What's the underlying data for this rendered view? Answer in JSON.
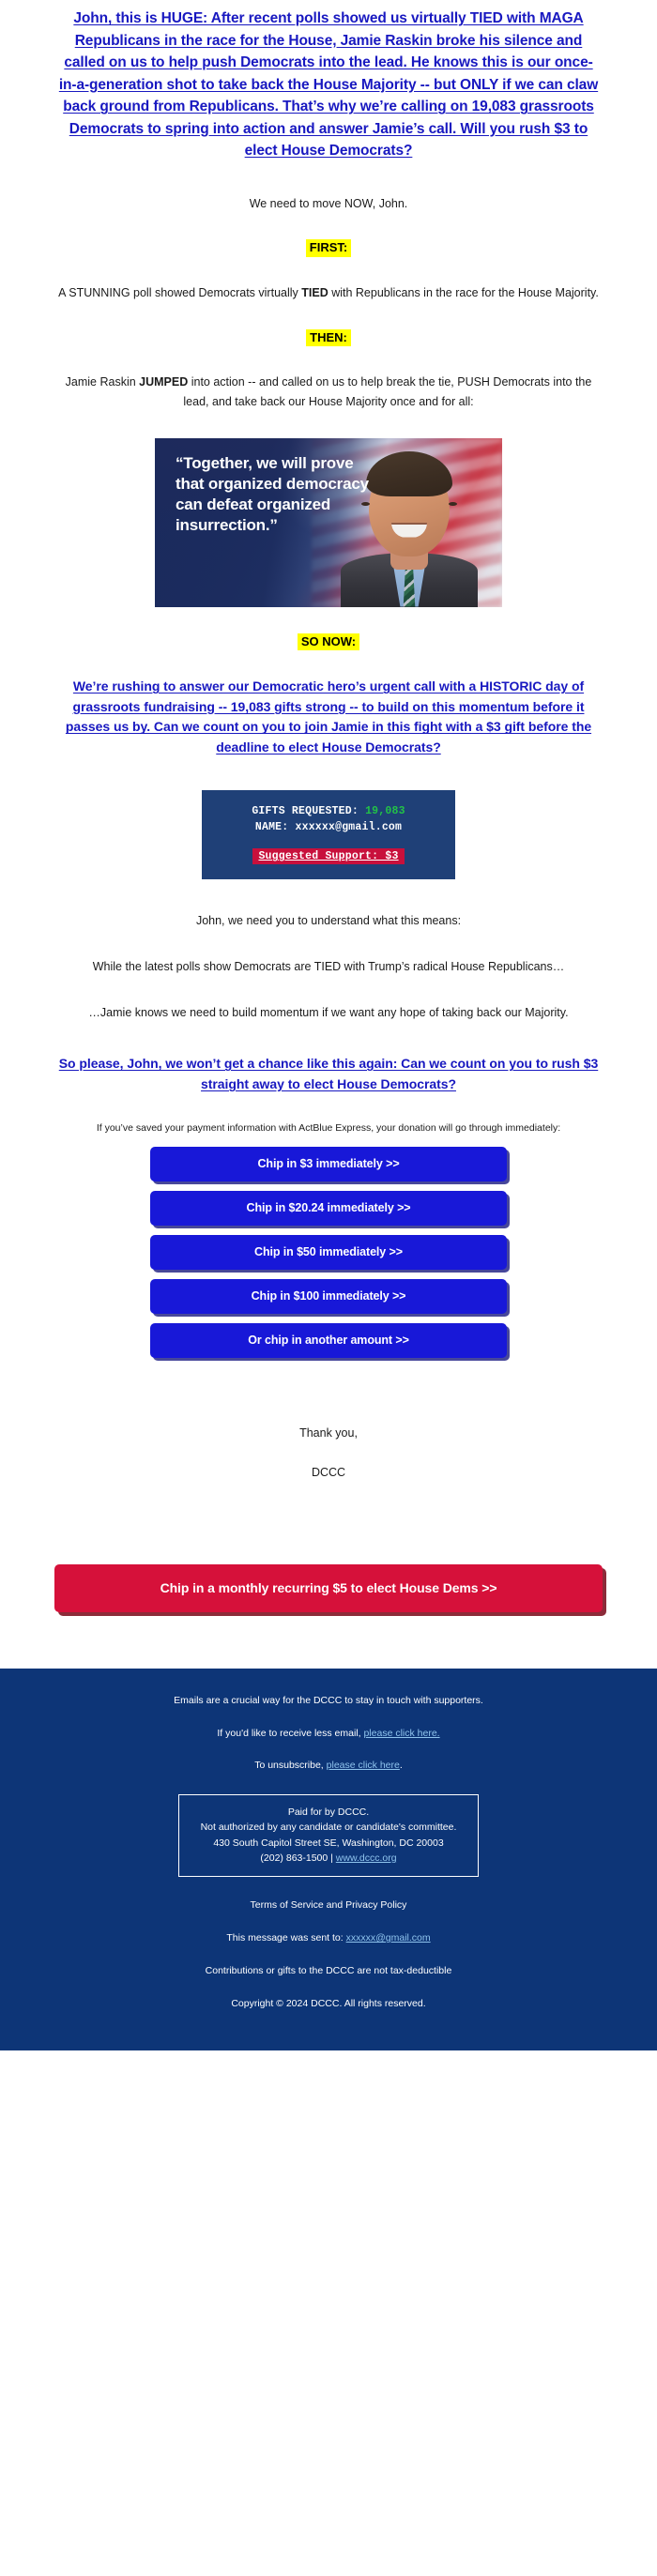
{
  "colors": {
    "headline_blue": "#1818c0",
    "highlight_yellow": "#ffff00",
    "button_blue": "#1818d8",
    "button_red": "#d6113a",
    "footer_navy": "#0d3577",
    "gift_box_navy": "#1f4077",
    "gift_count_green": "#22c247",
    "suggested_support_red": "#c8103c",
    "footer_link_blue": "#8fc4ee"
  },
  "headline": "John, this is HUGE: After recent polls showed us virtually TIED with MAGA Republicans in the race for the House, Jamie Raskin broke his silence and called on us to help push Democrats into the lead. He knows this is our once-in-a-generation shot to take back the House Majority -- but ONLY if we can claw back ground from Republicans. That’s why we’re calling on 19,083 grassroots Democrats to spring into action and answer Jamie’s call. Will you rush $3 to elect House Democrats?",
  "intro_line": "We need to move NOW, John.",
  "first_label": "FIRST:",
  "first_para_before": "A STUNNING poll showed Democrats virtually ",
  "first_para_bold": "TIED",
  "first_para_after": " with Republicans in the race for the House Majority.",
  "then_label": "THEN:",
  "then_para_before": "Jamie Raskin ",
  "then_para_bold": "JUMPED",
  "then_para_after": " into action -- and called on us to help break the tie, PUSH Democrats into the lead, and take back our House Majority once and for all:",
  "quote_image": {
    "quote": "“Together, we will prove that organized democracy can defeat organized insurrection.”",
    "person": "Jamie Raskin"
  },
  "so_now_label": "SO NOW:",
  "so_now_cta": "We’re rushing to answer our Democratic hero’s urgent call with a HISTORIC day of grassroots fundraising -- 19,083 gifts strong -- to build on this momentum before it passes us by. Can we count on you to join Jamie in this fight with a $3 gift before the deadline to elect House Democrats?",
  "gift_box": {
    "gifts_requested_label": "GIFTS REQUESTED:",
    "gifts_requested_value": "19,083",
    "name_label": "NAME:",
    "name_value": "xxxxxx@gmail.com",
    "suggested_support": "Suggested Support: $3"
  },
  "mid_paras": [
    "John, we need you to understand what this means:",
    "While the latest polls show Democrats are TIED with Trump’s radical House Republicans…",
    "…Jamie knows we need to build momentum if we want any hope of taking back our Majority."
  ],
  "final_cta": "So please, John, we won’t get a chance like this again: Can we count on you to rush $3 straight away to elect House Democrats?",
  "actblue_note": "If you’ve saved your payment information with ActBlue Express, your donation will go through immediately:",
  "donate_buttons": [
    "Chip in $3 immediately >>",
    "Chip in $20.24 immediately >>",
    "Chip in $50 immediately >>",
    "Chip in $100 immediately >>",
    "Or chip in another amount >>"
  ],
  "signoff": {
    "thanks": "Thank you,",
    "org": "DCCC"
  },
  "recurring_button": "Chip in a monthly recurring $5 to elect House Dems >>",
  "footer": {
    "line1": "Emails are a crucial way for the DCCC to stay in touch with supporters.",
    "less_email_prefix": "If you'd like to receive less email, ",
    "less_email_link": "please click here.",
    "unsubscribe_prefix": "To unsubscribe, ",
    "unsubscribe_link": "please click here",
    "unsubscribe_suffix": ".",
    "paid_for": "Paid for by DCCC.",
    "not_authorized": "Not authorized by any candidate or candidate's committee.",
    "address": "430 South Capitol Street SE, Washington, DC 20003",
    "phone": "(202) 863-1500 | ",
    "website": "www.dccc.org",
    "terms": "Terms of Service and Privacy Policy",
    "sent_to_prefix": "This message was sent to: ",
    "sent_to_email": "xxxxxx@gmail.com",
    "tax": "Contributions or gifts to the DCCC are not tax-deductible",
    "copyright": "Copyright © 2024 DCCC. All rights reserved."
  }
}
